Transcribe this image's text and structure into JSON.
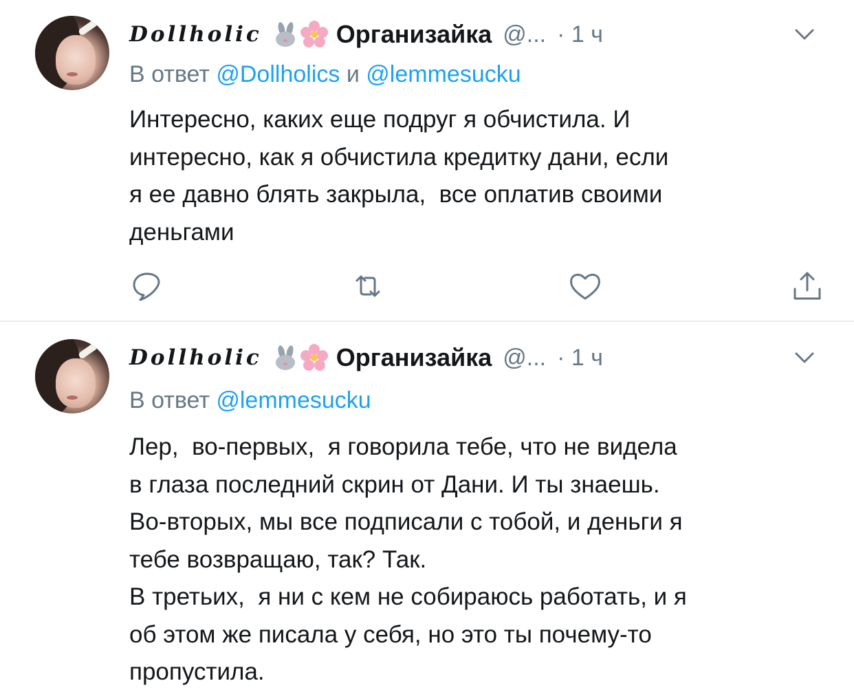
{
  "tweets": [
    {
      "display_name": "Dollholic",
      "org_name": "Организайка",
      "handle": "@...",
      "time": "· 1 ч",
      "reply_prefix": "В ответ",
      "reply_mentions": [
        "@Dollholics",
        "@lemmesucku"
      ],
      "reply_joiner": "и",
      "text_lines": [
        "Интересно, каких еще подруг я обчистила. И",
        "интересно, как я обчистила кредитку дани, если",
        "я ее давно блять закрыла,  все оплатив своими",
        "деньгами"
      ],
      "icons": [
        "avatar",
        "bunny-emoji",
        "cherry-blossom-emoji",
        "chevron-down-icon",
        "reply-icon",
        "retweet-icon",
        "like-icon",
        "share-icon"
      ]
    },
    {
      "display_name": "Dollholic",
      "org_name": "Организайка",
      "handle": "@...",
      "time": "· 1 ч",
      "reply_prefix": "В ответ",
      "reply_mentions": [
        "@lemmesucku"
      ],
      "text_lines": [
        "Лер,  во-первых,  я говорила тебе, что не видела",
        "в глаза последний скрин от Дани. И ты знаешь.",
        "Во-вторых, мы все подписали с тобой, и деньги я",
        "тебе возвращаю, так? Так.",
        "В третьих,  я ни с кем не собираюсь работать, и я",
        "об этом же писала у себя, но это ты почему-то",
        "пропустила."
      ],
      "icons": [
        "avatar",
        "bunny-emoji",
        "cherry-blossom-emoji",
        "chevron-down-icon"
      ]
    }
  ],
  "colors": {
    "text": "#14171a",
    "secondary": "#657786",
    "link": "#1da1f2",
    "divider": "#e6ecf0"
  }
}
